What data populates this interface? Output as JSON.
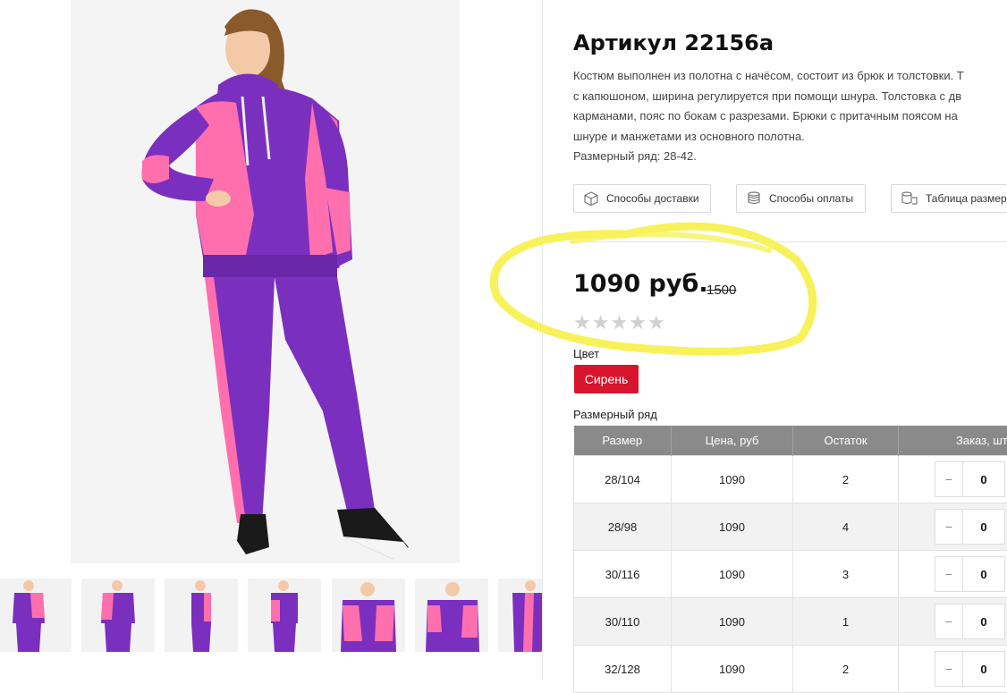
{
  "product": {
    "title": "Артикул 22156а",
    "description_lines": [
      "Костюм выполнен из полотна с начёсом, состоит из брюк и толстовки. Т",
      "с капюшоном, ширина регулируется при помощи шнура. Толстовка с дв",
      "карманами, пояс по бокам с разрезами. Брюки с притачным поясом на",
      "шнуре и манжетами из основного полотна.",
      "Размерный ряд: 28-42."
    ]
  },
  "info_buttons": {
    "delivery": "Способы доставки",
    "payment": "Способы оплаты",
    "size_chart": "Таблица размер"
  },
  "price": {
    "current": "1090 руб.",
    "old": "1500",
    "rating_stars": 0,
    "max_stars": 5
  },
  "color": {
    "label": "Цвет",
    "selected": "Сирень",
    "accent": "#d7152d"
  },
  "sizes": {
    "label": "Размерный ряд",
    "headers": [
      "Размер",
      "Цена, руб",
      "Остаток",
      "Заказ, шт"
    ],
    "rows": [
      {
        "size": "28/104",
        "price": "1090",
        "stock": "2",
        "qty": "0"
      },
      {
        "size": "28/98",
        "price": "1090",
        "stock": "4",
        "qty": "0"
      },
      {
        "size": "30/116",
        "price": "1090",
        "stock": "3",
        "qty": "0"
      },
      {
        "size": "30/110",
        "price": "1090",
        "stock": "1",
        "qty": "0"
      },
      {
        "size": "32/128",
        "price": "1090",
        "stock": "2",
        "qty": "0"
      }
    ],
    "minus_symbol": "−"
  },
  "colors": {
    "suit_purple": "#7b2fbf",
    "suit_pink": "#ff6fae",
    "highlight": "#f7f25a"
  }
}
